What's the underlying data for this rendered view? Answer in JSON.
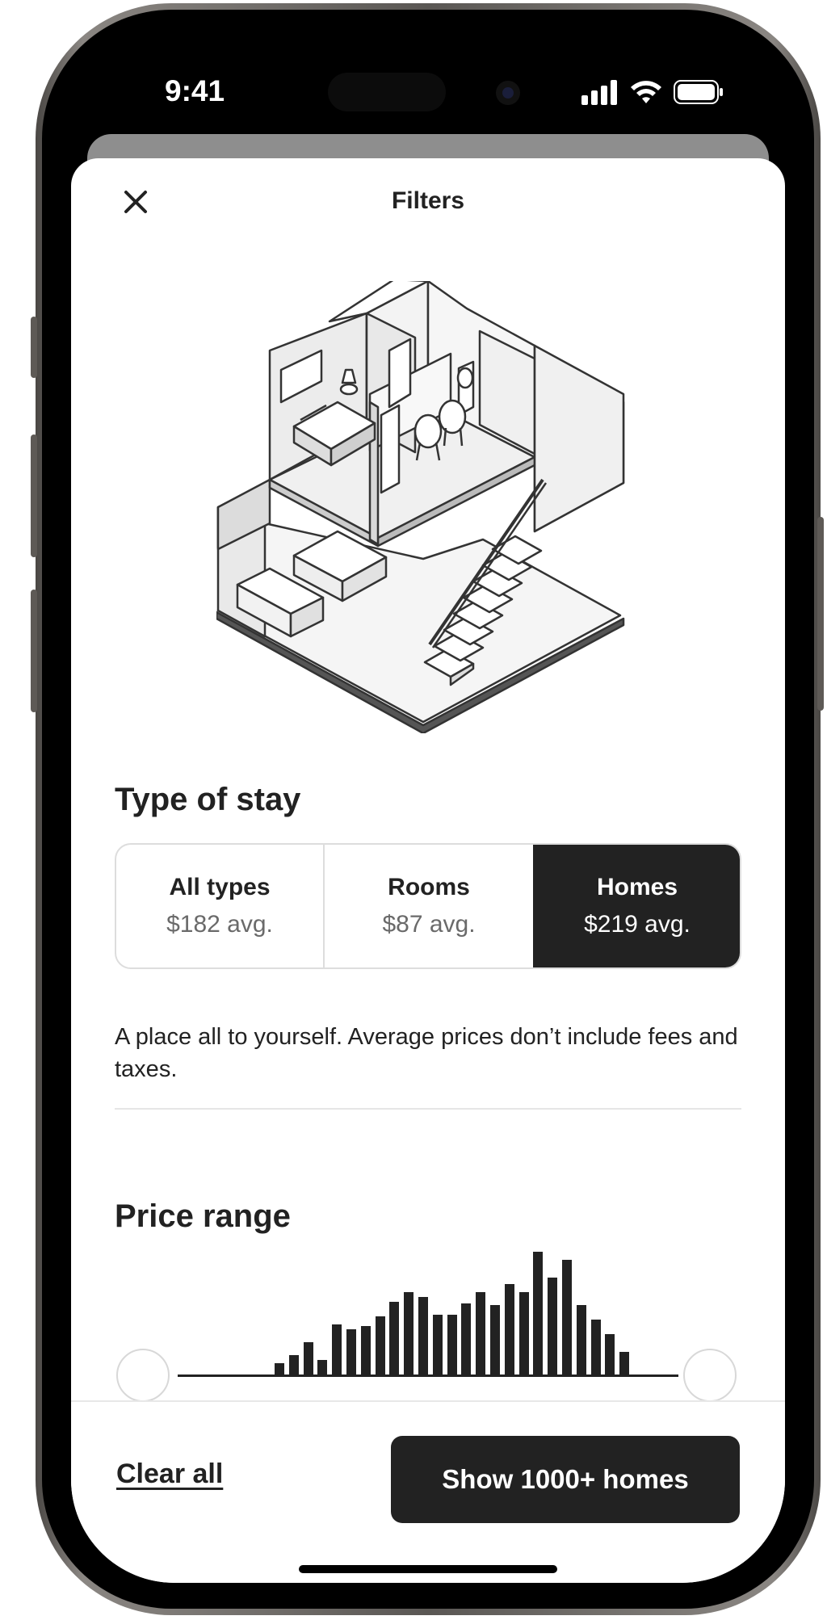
{
  "status_bar": {
    "time": "9:41"
  },
  "header": {
    "title": "Filters",
    "close_icon": "close-icon"
  },
  "type_of_stay": {
    "heading": "Type of stay",
    "options": [
      {
        "label": "All types",
        "avg": "$182 avg.",
        "selected": false
      },
      {
        "label": "Rooms",
        "avg": "$87 avg.",
        "selected": false
      },
      {
        "label": "Homes",
        "avg": "$219 avg.",
        "selected": true
      }
    ],
    "description": "A place all to yourself. Average prices don’t include fees and taxes."
  },
  "price_range": {
    "heading": "Price range",
    "histogram_heights": [
      16,
      26,
      42,
      20,
      64,
      58,
      62,
      74,
      92,
      104,
      98,
      76,
      76,
      90,
      104,
      88,
      114,
      104,
      154,
      122,
      144,
      88,
      70,
      52,
      30
    ],
    "min_handle": 0,
    "max_handle": 1
  },
  "footer": {
    "clear_label": "Clear all",
    "show_label": "Show 1000+ homes"
  },
  "colors": {
    "primary": "#222222",
    "border": "#dddddd",
    "muted": "#6a6a6a"
  }
}
